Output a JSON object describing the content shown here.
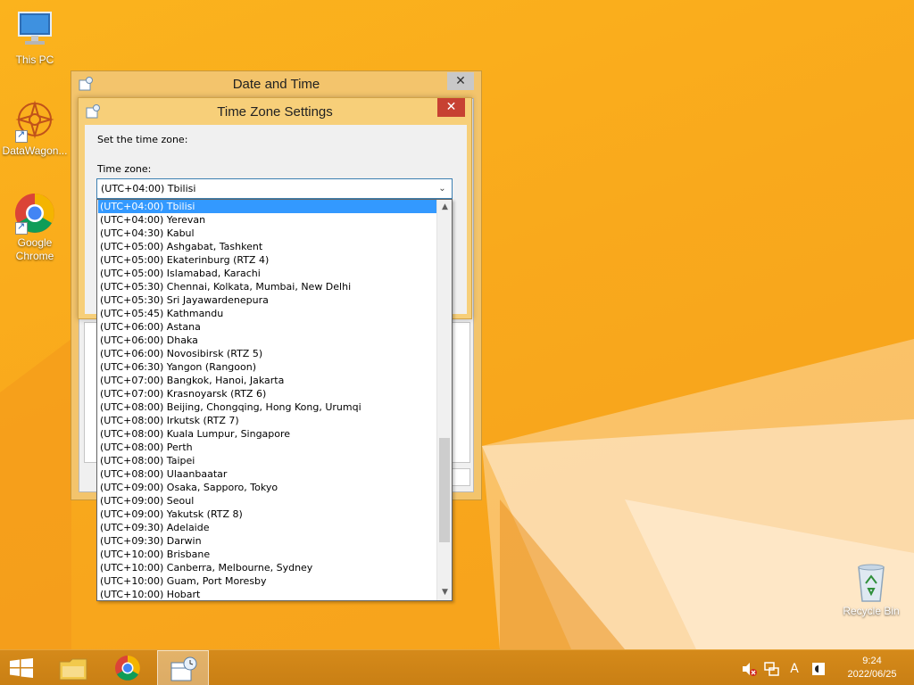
{
  "desktop": {
    "icons": [
      {
        "label": "This PC"
      },
      {
        "label": "DataWagon..."
      },
      {
        "label": "Google Chrome"
      }
    ],
    "recycle_bin": {
      "label": "Recycle Bin"
    }
  },
  "date_time_window": {
    "title": "Date and Time",
    "close_glyph": "✕"
  },
  "tz_dialog": {
    "title": "Time Zone Settings",
    "close_glyph": "✕",
    "prompt": "Set the time zone:",
    "field_label": "Time zone:",
    "selected_value": "(UTC+04:00) Tbilisi",
    "options": [
      "(UTC+04:00) Tbilisi",
      "(UTC+04:00) Yerevan",
      "(UTC+04:30) Kabul",
      "(UTC+05:00) Ashgabat, Tashkent",
      "(UTC+05:00) Ekaterinburg (RTZ 4)",
      "(UTC+05:00) Islamabad, Karachi",
      "(UTC+05:30) Chennai, Kolkata, Mumbai, New Delhi",
      "(UTC+05:30) Sri Jayawardenepura",
      "(UTC+05:45) Kathmandu",
      "(UTC+06:00) Astana",
      "(UTC+06:00) Dhaka",
      "(UTC+06:00) Novosibirsk (RTZ 5)",
      "(UTC+06:30) Yangon (Rangoon)",
      "(UTC+07:00) Bangkok, Hanoi, Jakarta",
      "(UTC+07:00) Krasnoyarsk (RTZ 6)",
      "(UTC+08:00) Beijing, Chongqing, Hong Kong, Urumqi",
      "(UTC+08:00) Irkutsk (RTZ 7)",
      "(UTC+08:00) Kuala Lumpur, Singapore",
      "(UTC+08:00) Perth",
      "(UTC+08:00) Taipei",
      "(UTC+08:00) Ulaanbaatar",
      "(UTC+09:00) Osaka, Sapporo, Tokyo",
      "(UTC+09:00) Seoul",
      "(UTC+09:00) Yakutsk (RTZ 8)",
      "(UTC+09:30) Adelaide",
      "(UTC+09:30) Darwin",
      "(UTC+10:00) Brisbane",
      "(UTC+10:00) Canberra, Melbourne, Sydney",
      "(UTC+10:00) Guam, Port Moresby",
      "(UTC+10:00) Hobart"
    ],
    "selected_index": 0,
    "scroll": {
      "thumb_start_fraction": 0.6,
      "thumb_length_fraction": 0.28
    },
    "arrow_glyph": "⌄"
  },
  "taskbar": {
    "clock_time": "9:24",
    "clock_date": "2022/06/25",
    "ime_glyph": "A"
  },
  "colors": {
    "accent_orange": "#f9a91c",
    "selection_blue": "#3399ff",
    "close_red": "#c74132"
  }
}
